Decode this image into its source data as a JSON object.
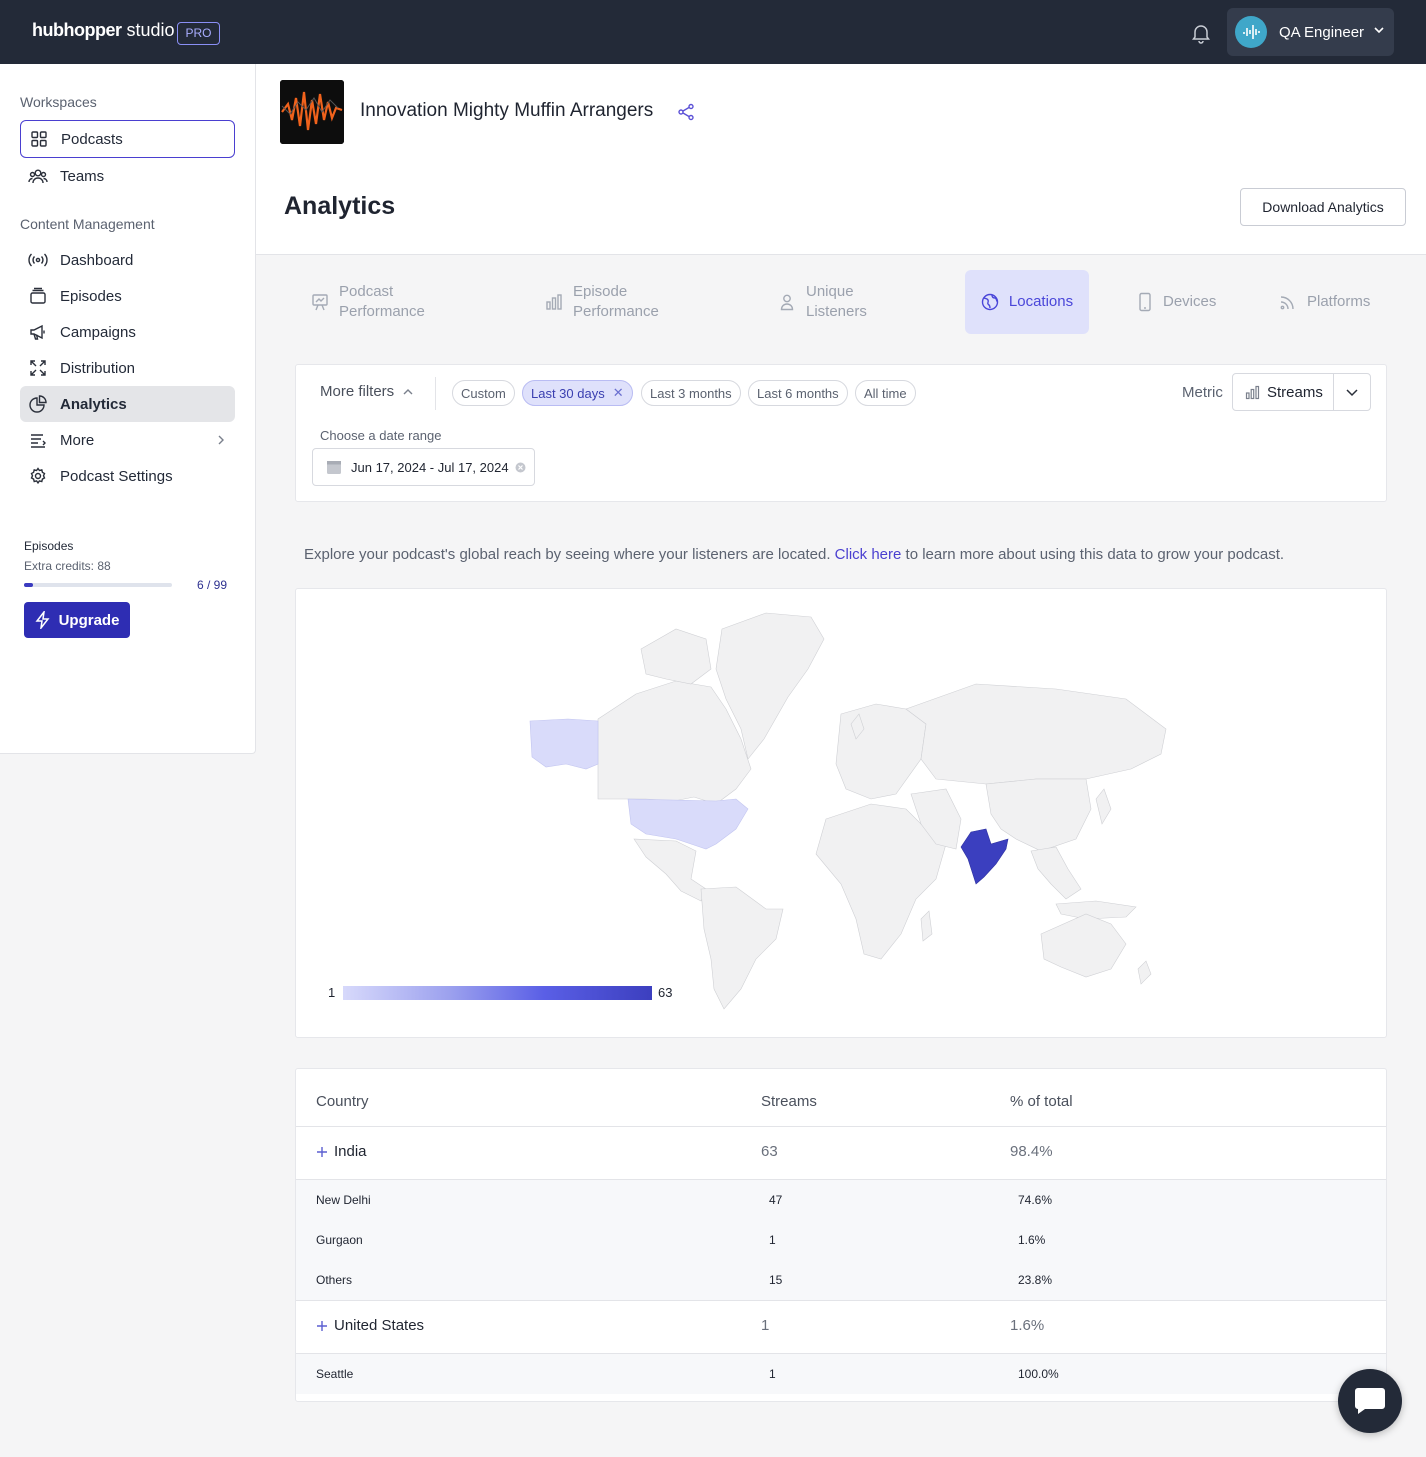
{
  "topbar": {
    "brand_bold": "hubhopper",
    "brand_light": "studio",
    "plan_badge": "PRO",
    "user_name": "QA Engineer"
  },
  "sidebar": {
    "workspaces_heading": "Workspaces",
    "workspace_items": [
      {
        "label": "Podcasts",
        "icon": "grid-icon"
      },
      {
        "label": "Teams",
        "icon": "people-icon"
      }
    ],
    "content_heading": "Content Management",
    "content_items": [
      {
        "label": "Dashboard",
        "icon": "broadcast-icon"
      },
      {
        "label": "Episodes",
        "icon": "stack-icon"
      },
      {
        "label": "Campaigns",
        "icon": "megaphone-icon"
      },
      {
        "label": "Distribution",
        "icon": "expand-icon"
      },
      {
        "label": "Analytics",
        "icon": "pie-chart-icon"
      },
      {
        "label": "More",
        "icon": "list-icon"
      },
      {
        "label": "Podcast Settings",
        "icon": "gear-icon"
      }
    ],
    "episodes": {
      "label": "Episodes",
      "credits": "Extra credits: 88",
      "count": "6 / 99",
      "used_fraction": 0.0606
    },
    "upgrade_label": "Upgrade"
  },
  "header": {
    "podcast_title": "Innovation Mighty Muffin Arrangers",
    "page_title": "Analytics",
    "download_label": "Download Analytics"
  },
  "tabs": [
    {
      "line1": "Podcast",
      "line2": "Performance",
      "icon": "presentation-icon"
    },
    {
      "line1": "Episode",
      "line2": "Performance",
      "icon": "bar-chart-icon"
    },
    {
      "line1": "Unique",
      "line2": "Listeners",
      "icon": "user-icon"
    },
    {
      "line1": "Locations",
      "line2": "",
      "icon": "globe-icon",
      "active": true
    },
    {
      "line1": "Devices",
      "line2": "",
      "icon": "phone-icon"
    },
    {
      "line1": "Platforms",
      "line2": "",
      "icon": "rss-icon"
    }
  ],
  "filters": {
    "more_filters_label": "More filters",
    "chips": [
      {
        "label": "Custom",
        "active": false
      },
      {
        "label": "Last 30 days",
        "active": true
      },
      {
        "label": "Last 3 months",
        "active": false
      },
      {
        "label": "Last 6 months",
        "active": false
      },
      {
        "label": "All time",
        "active": false
      }
    ],
    "metric_label": "Metric",
    "metric_value": "Streams",
    "range_label": "Choose a date range",
    "range_value": "Jun 17, 2024 - Jul 17, 2024"
  },
  "explore": {
    "before": "Explore your podcast's global reach by seeing where your listeners are located.",
    "link": "Click here",
    "after": "to learn more about using this data to grow your podcast."
  },
  "map": {
    "legend_min": "1",
    "legend_max": "63",
    "highlighted": [
      {
        "country": "India",
        "value": 63,
        "color": "#3b3fbf"
      },
      {
        "country": "United States",
        "value": 1,
        "color": "#d9dbfa"
      }
    ]
  },
  "table": {
    "headers": [
      "Country",
      "Streams",
      "% of total"
    ],
    "countries": [
      {
        "name": "India",
        "streams": "63",
        "pct": "98.4%",
        "cities": [
          {
            "name": "New Delhi",
            "streams": "47",
            "pct": "74.6%"
          },
          {
            "name": "Gurgaon",
            "streams": "1",
            "pct": "1.6%"
          },
          {
            "name": "Others",
            "streams": "15",
            "pct": "23.8%"
          }
        ]
      },
      {
        "name": "United States",
        "streams": "1",
        "pct": "1.6%",
        "cities": [
          {
            "name": "Seattle",
            "streams": "1",
            "pct": "100.0%"
          }
        ]
      }
    ]
  },
  "colors": {
    "accent": "#4a3fd0",
    "topbar": "#232a38",
    "map_high": "#3b3fbf",
    "map_low": "#d9dbfa"
  }
}
